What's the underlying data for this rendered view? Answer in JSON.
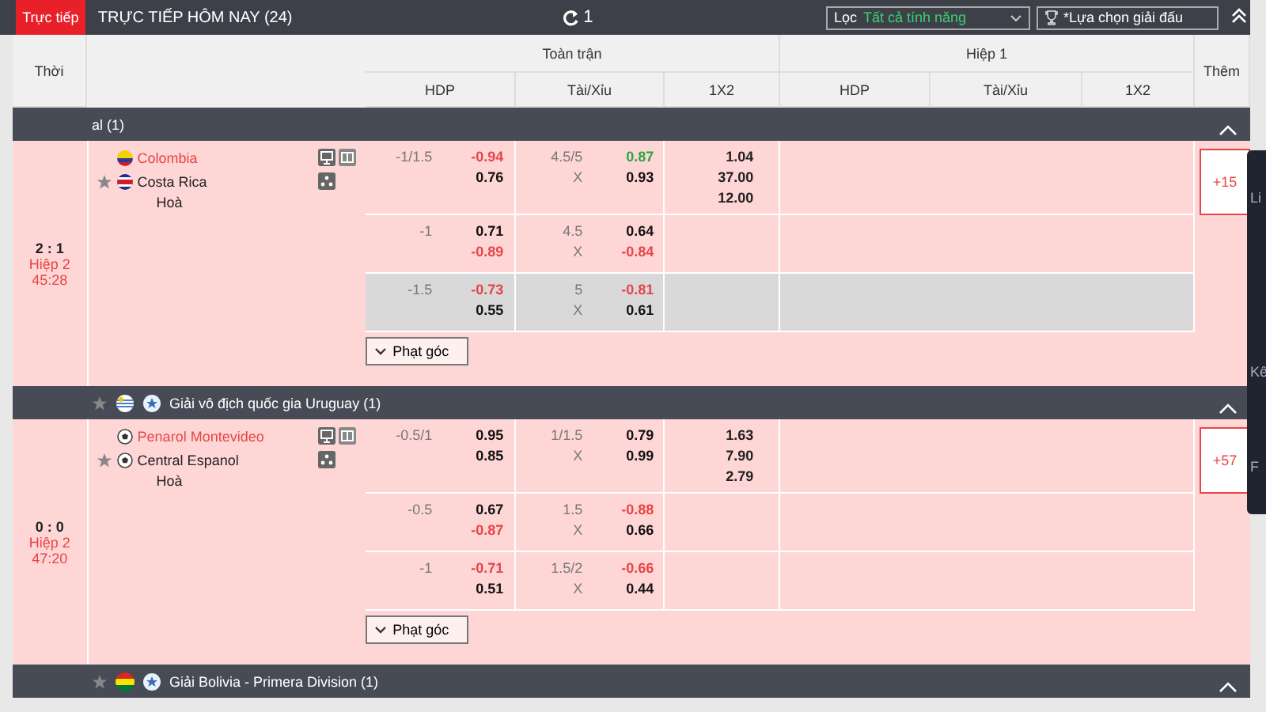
{
  "topbar": {
    "live_tab": "Trực tiếp",
    "title": "TRỰC TIẾP HÔM NAY (24)",
    "refresh_count": "1",
    "filter_label": "Lọc",
    "filter_value": "Tất cả tính năng",
    "league_picker": "*Lựa chọn giải đấu"
  },
  "header": {
    "time": "Thời",
    "full_match": "Toàn trận",
    "first_half": "Hiệp 1",
    "more": "Thêm",
    "columns": [
      "HDP",
      "Tài/Xỉu",
      "1X2",
      "HDP",
      "Tài/Xỉu",
      "1X2"
    ]
  },
  "leagues": [
    {
      "name": "al (1)",
      "expanded": true,
      "matches": [
        {
          "score": "2 : 1",
          "period": "Hiệp 2",
          "clock": "45:28",
          "home": {
            "name": "Colombia",
            "kind": "flag"
          },
          "away": {
            "name": "Costa Rica",
            "kind": "flag"
          },
          "draw": "Hoà",
          "more": "+15",
          "corner": "Phạt góc",
          "lines": [
            {
              "highlighted": false,
              "hdp": "-1/1.5",
              "hdp_odds": [
                {
                  "value": "-0.94",
                  "color": "#e84545"
                },
                {
                  "value": "0.76",
                  "color": "#111111"
                }
              ],
              "ou": "4.5/5",
              "ou_mark": "X",
              "ou_odds": [
                {
                  "value": "0.87",
                  "color": "#2aa845"
                },
                {
                  "value": "0.93",
                  "color": "#111111"
                }
              ],
              "x12": [
                "1.04",
                "37.00",
                "12.00"
              ]
            },
            {
              "highlighted": false,
              "hdp": "-1",
              "hdp_odds": [
                {
                  "value": "0.71",
                  "color": "#111111"
                },
                {
                  "value": "-0.89",
                  "color": "#e84545"
                }
              ],
              "ou": "4.5",
              "ou_mark": "X",
              "ou_odds": [
                {
                  "value": "0.64",
                  "color": "#111111"
                },
                {
                  "value": "-0.84",
                  "color": "#e84545"
                }
              ]
            },
            {
              "highlighted": true,
              "hdp": "-1.5",
              "hdp_odds": [
                {
                  "value": "-0.73",
                  "color": "#e84545"
                },
                {
                  "value": "0.55",
                  "color": "#111111"
                }
              ],
              "ou": "5",
              "ou_mark": "X",
              "ou_odds": [
                {
                  "value": "-0.81",
                  "color": "#e84545"
                },
                {
                  "value": "0.61",
                  "color": "#111111"
                }
              ]
            }
          ]
        }
      ]
    },
    {
      "name": "Giải vô địch quốc gia Uruguay (1)",
      "icons": true,
      "expanded": true,
      "matches": [
        {
          "score": "0 : 0",
          "period": "Hiệp 2",
          "clock": "47:20",
          "home": {
            "name": "Penarol Montevideo",
            "kind": "ball"
          },
          "away": {
            "name": "Central Espanol",
            "kind": "ball"
          },
          "draw": "Hoà",
          "more": "+57",
          "corner": "Phạt góc",
          "lines": [
            {
              "highlighted": false,
              "hdp": "-0.5/1",
              "hdp_odds": [
                {
                  "value": "0.95",
                  "color": "#111111"
                },
                {
                  "value": "0.85",
                  "color": "#111111"
                }
              ],
              "ou": "1/1.5",
              "ou_mark": "X",
              "ou_odds": [
                {
                  "value": "0.79",
                  "color": "#111111"
                },
                {
                  "value": "0.99",
                  "color": "#111111"
                }
              ],
              "x12": [
                "1.63",
                "7.90",
                "2.79"
              ]
            },
            {
              "highlighted": false,
              "hdp": "-0.5",
              "hdp_odds": [
                {
                  "value": "0.67",
                  "color": "#111111"
                },
                {
                  "value": "-0.87",
                  "color": "#e84545"
                }
              ],
              "ou": "1.5",
              "ou_mark": "X",
              "ou_odds": [
                {
                  "value": "-0.88",
                  "color": "#e84545"
                },
                {
                  "value": "0.66",
                  "color": "#111111"
                }
              ]
            },
            {
              "highlighted": false,
              "hdp": "-1",
              "hdp_odds": [
                {
                  "value": "-0.71",
                  "color": "#e84545"
                },
                {
                  "value": "0.51",
                  "color": "#111111"
                }
              ],
              "ou": "1.5/2",
              "ou_mark": "X",
              "ou_odds": [
                {
                  "value": "-0.66",
                  "color": "#e84545"
                },
                {
                  "value": "0.44",
                  "color": "#111111"
                }
              ]
            }
          ]
        }
      ]
    },
    {
      "name": "Giải Bolivia - Primera Division (1)",
      "icons": true,
      "expanded": true
    }
  ],
  "side_panel": {
    "labels": [
      "Li",
      "Kê",
      "F"
    ]
  }
}
